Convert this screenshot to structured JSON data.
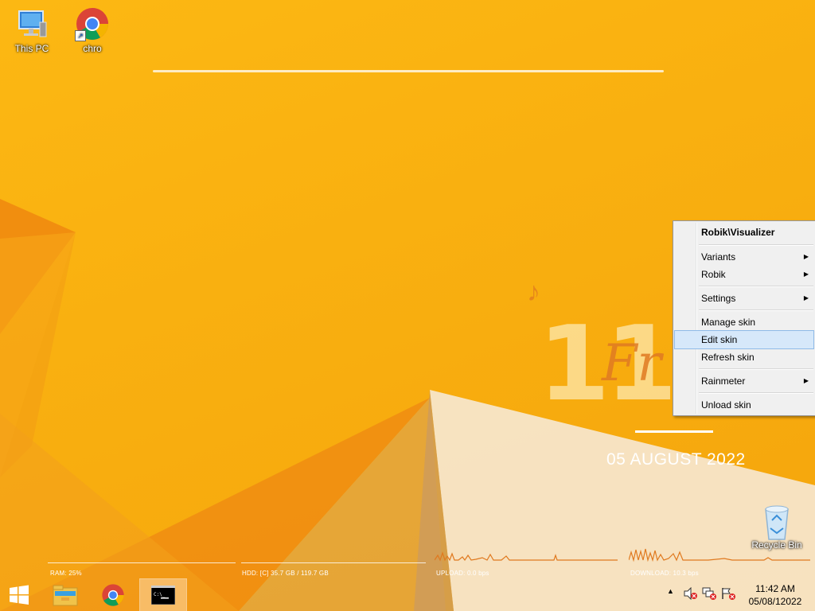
{
  "desktop": {
    "icons": [
      {
        "label": "This PC",
        "icon": "computer-icon"
      },
      {
        "label": "chro",
        "icon": "chrome-icon"
      },
      {
        "label": "Recycle Bin",
        "icon": "recycle-bin-icon"
      }
    ]
  },
  "skin": {
    "time_hour": "11",
    "day_script": "Fr",
    "date": "05 AUGUST 2022",
    "music_note": "♪"
  },
  "context_menu": {
    "header": "Robik\\Visualizer",
    "items": [
      {
        "label": "Variants",
        "submenu": true
      },
      {
        "label": "Robik",
        "submenu": true
      },
      {
        "label": "Settings",
        "submenu": true
      },
      {
        "label": "Manage skin",
        "submenu": false
      },
      {
        "label": "Edit skin",
        "submenu": false,
        "highlighted": true
      },
      {
        "label": "Refresh skin",
        "submenu": false
      },
      {
        "label": "Rainmeter",
        "submenu": true
      },
      {
        "label": "Unload skin",
        "submenu": false
      }
    ],
    "submenu_glyph": "▶"
  },
  "meters": {
    "ram": "RAM: 25%",
    "hdd": "HDD: [C] 35.7 GB / 119.7 GB",
    "upload": "UPLOAD: 0.0 bps",
    "download": "DOWNLOAD: 10.3 bps"
  },
  "taskbar": {
    "buttons": [
      "start-button",
      "file-explorer",
      "chrome",
      "command-prompt"
    ],
    "active": "command-prompt",
    "tray_overflow": "▲",
    "time": "11:42 AM",
    "date": "05/08/12022"
  },
  "colors": {
    "wallpaper": "#fcb813",
    "accent_orange": "#e07a22",
    "menu_highlight": "#d6e8fa"
  }
}
